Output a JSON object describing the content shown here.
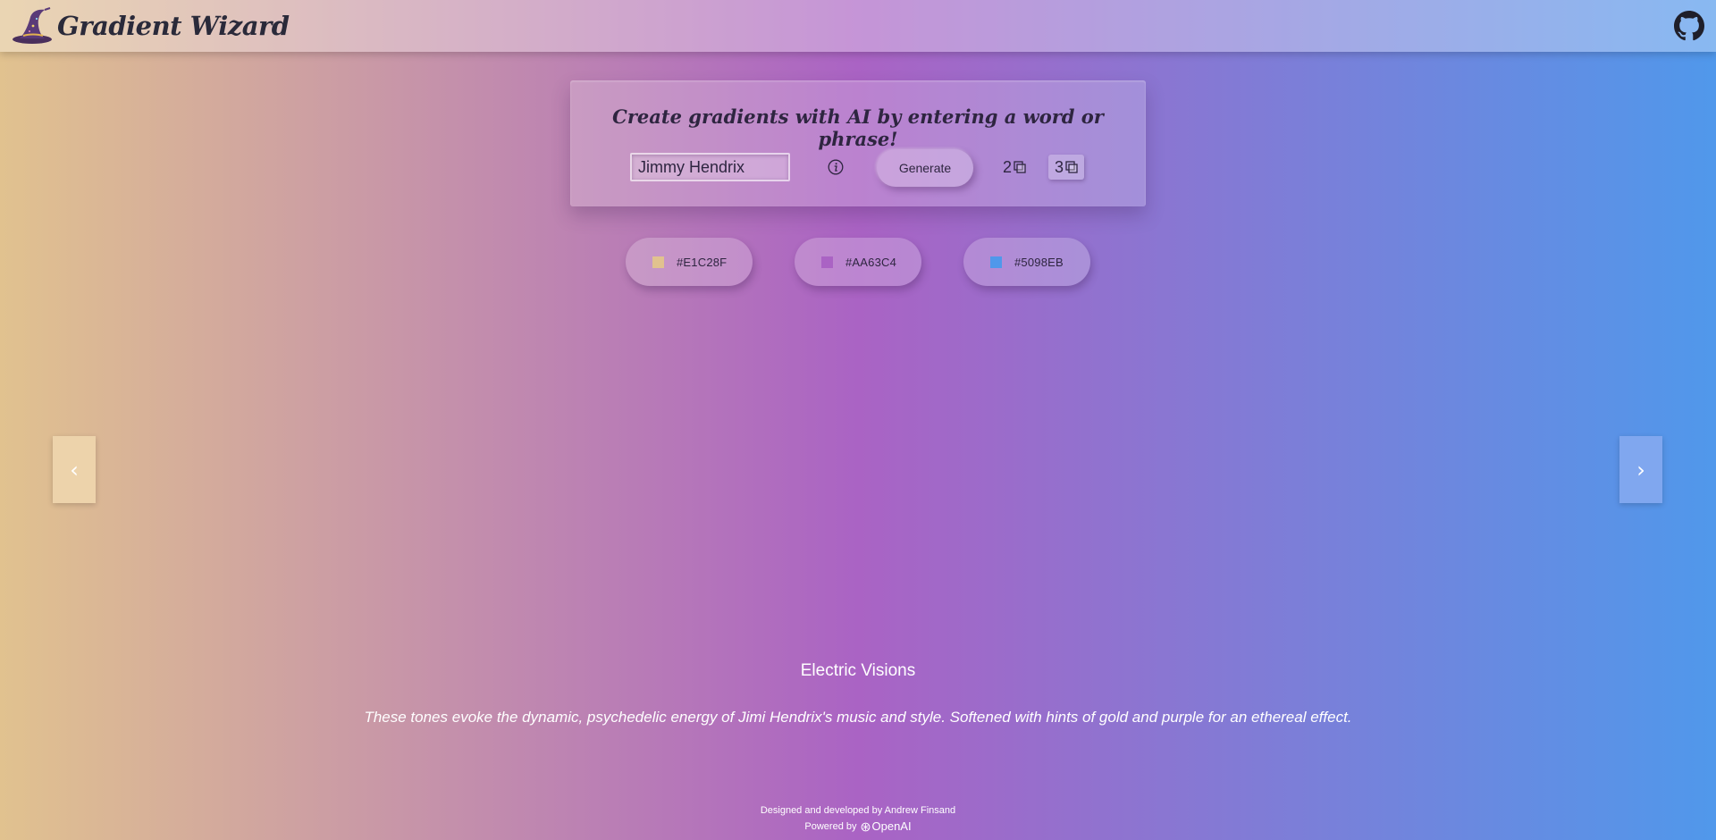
{
  "header": {
    "app_title": "Gradient Wizard",
    "logo_icon": "wizard-hat-icon",
    "github_icon": "github-icon"
  },
  "card": {
    "heading": "Create gradients with AI by entering a word or phrase!",
    "prompt": {
      "value": "Jimmy Hendrix",
      "placeholder": ""
    },
    "info_icon": "info-icon",
    "generate_label": "Generate",
    "count_options": [
      {
        "label": "2",
        "icon": "stack-icon",
        "selected": false
      },
      {
        "label": "3",
        "icon": "stack-icon",
        "selected": true
      }
    ]
  },
  "colors": [
    {
      "hex": "#E1C28F",
      "label": "#E1C28F"
    },
    {
      "hex": "#AA63C4",
      "label": "#AA63C4"
    },
    {
      "hex": "#5098EB",
      "label": "#5098EB"
    }
  ],
  "navigation": {
    "prev_label": "‹",
    "next_label": "›"
  },
  "gradient": {
    "name": "Electric Visions",
    "description": "These tones evoke the dynamic, psychedelic energy of Jimi Hendrix's music and style. Softened with hints of gold and purple for an ethereal effect."
  },
  "footer": {
    "credit": "Designed and developed by Andrew Finsand",
    "powered_by": "Powered by",
    "provider": "OpenAI"
  }
}
